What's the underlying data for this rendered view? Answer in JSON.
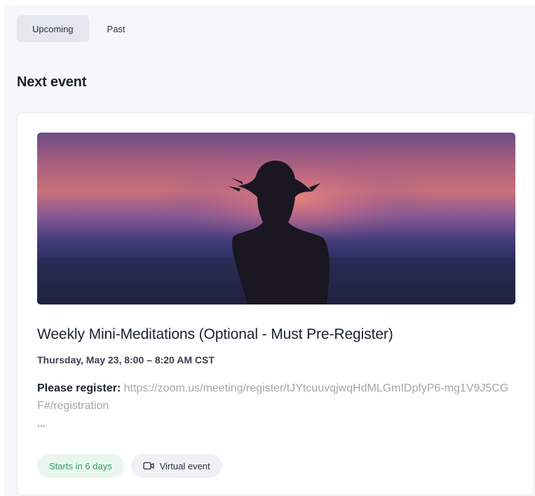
{
  "tabs": [
    {
      "label": "Upcoming",
      "active": true
    },
    {
      "label": "Past",
      "active": false
    }
  ],
  "section_title": "Next event",
  "event": {
    "image_alt": "Silhouette of a woman against a purple sunset",
    "title": "Weekly Mini-Meditations (Optional - Must Pre-Register)",
    "datetime": "Thursday, May 23, 8:00 – 8:20 AM CST",
    "description_label": "Please register:",
    "description_link": "https://zoom.us/meeting/register/tJYtcuuvqjwqHdMLGmIDpfyP6-mg1V9J5CGF#/registration",
    "ellipsis": "...",
    "badges": {
      "starts": "Starts in 6 days",
      "virtual": "Virtual event",
      "virtual_icon": "video-camera-icon"
    }
  },
  "colors": {
    "active_tab_bg": "#e4e8ee",
    "link": "#a5a8a0",
    "green_badge_text": "#3b9a64",
    "green_badge_bg": "#e9f6ee"
  }
}
